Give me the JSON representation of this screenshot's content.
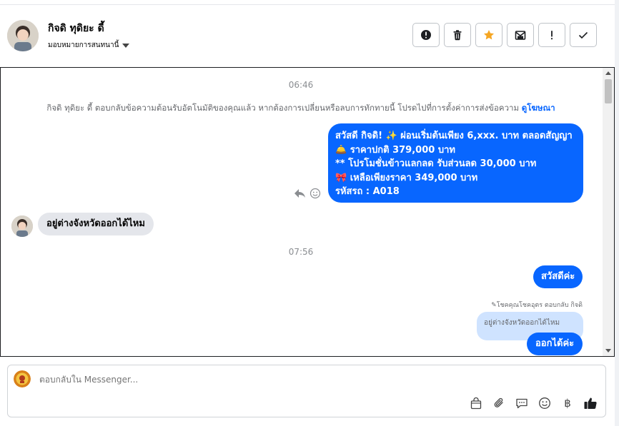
{
  "header": {
    "contact_name": "กิจดิ ทุดิยะ ดี้",
    "assign_label": "มอบหมายการสนทนานี้",
    "actions": [
      {
        "name": "alert-circle-icon",
        "label": "mark as spam"
      },
      {
        "name": "trash-icon",
        "label": "delete"
      },
      {
        "name": "star-icon",
        "label": "star"
      },
      {
        "name": "mark-unread-icon",
        "label": "mark unread"
      },
      {
        "name": "exclamation-icon",
        "label": "follow up"
      },
      {
        "name": "check-icon",
        "label": "mark done"
      }
    ]
  },
  "conversation": {
    "time1": "06:46",
    "system_note": "กิจดิ ทุดิยะ ดี้ ตอบกลับข้อความต้อนรับอัตโนมัติของคุณแล้ว หากต้องการเปลี่ยนหรือลบการทักทายนี้ โปรดไปที่การตั้งค่าการส่งข้อความ",
    "system_note_link": "ดูโฆษณา",
    "promo_lines": [
      "สวัสดี กิจดิ! ✨  ผ่อนเริ่มต้นเพียง 6,xxx. บาท ตลอดสัญญา",
      "🛎️ ราคาปกติ 379,000 บาท",
      "** โปรโมชั่นข้าวแลกลด รับส่วนลด 30,000 บาท",
      "🎀  เหลือเพียงราคา 349,000 บาท",
      " รหัสรถ : A018"
    ],
    "incoming_1": "อยู่ต่างจังหวัดออกได้ไหม",
    "time2": "07:56",
    "outgoing_hello": "สวัสดีค่ะ",
    "reply_header": "โชคคุณโชคอุตร ตอบกลับ กิจดิ",
    "quoted_text": "อยู่ต่างจังหวัดออกได้ไหม",
    "outgoing_ok": "ออกได้ค่ะ"
  },
  "composer": {
    "placeholder": "ตอบกลับใน Messenger...",
    "tools": [
      "shopping-bag-icon",
      "paperclip-icon",
      "quick-reply-icon",
      "emoji-icon",
      "baht-icon",
      "thumbs-up-icon"
    ],
    "baht_symbol": "฿"
  },
  "colors": {
    "accent": "#0866ff",
    "incoming_bubble": "#e4e6eb",
    "quoted_bubble": "#cfe3ff",
    "star": "#f5a623"
  }
}
